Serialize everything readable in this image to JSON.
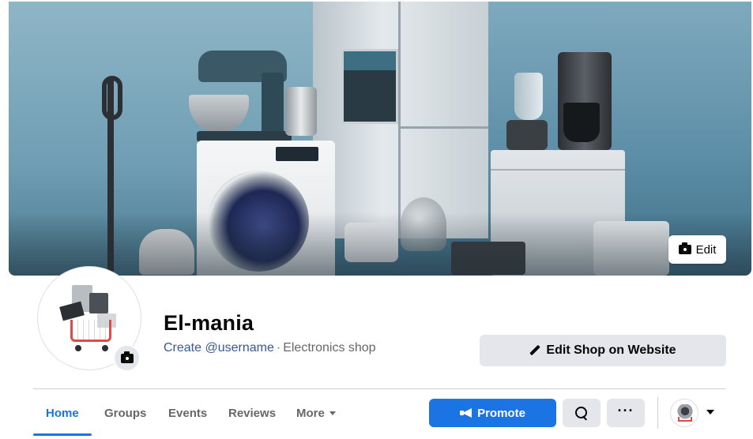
{
  "cover": {
    "edit_label": "Edit",
    "icon": "camera-icon"
  },
  "profile": {
    "name": "El-mania",
    "username_link": "Create @username",
    "separator": "·",
    "category": "Electronics shop",
    "avatar_icon": "camera-icon"
  },
  "actions": {
    "edit_shop_label": "Edit Shop on Website",
    "edit_shop_icon": "pencil-icon"
  },
  "tabs": [
    {
      "label": "Home",
      "active": true
    },
    {
      "label": "Groups",
      "active": false
    },
    {
      "label": "Events",
      "active": false
    },
    {
      "label": "Reviews",
      "active": false
    },
    {
      "label": "More",
      "active": false
    }
  ],
  "toolbar": {
    "promote_label": "Promote",
    "promote_icon": "megaphone-icon",
    "search_icon": "search-icon",
    "more_label": "···"
  },
  "colors": {
    "accent": "#1b74e4",
    "link": "#385898",
    "secondary_button": "#e4e6eb",
    "muted_text": "#65676b"
  }
}
